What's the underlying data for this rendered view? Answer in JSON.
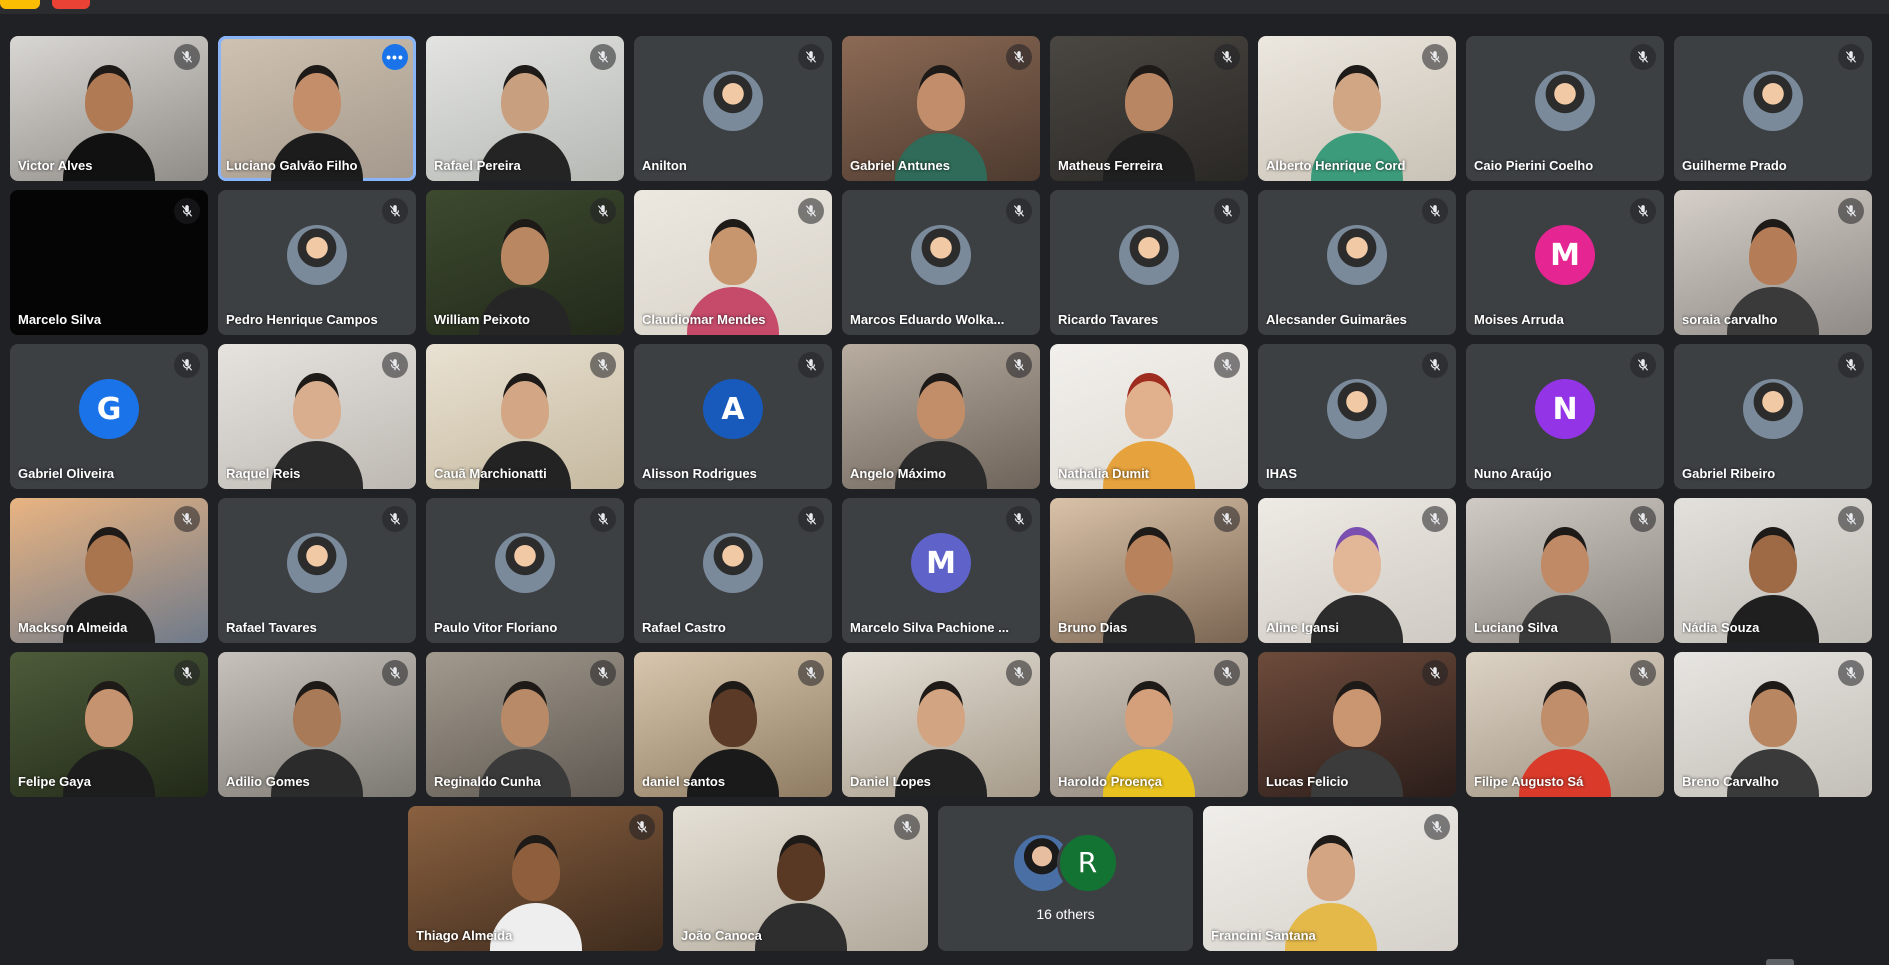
{
  "colors": {
    "background": "#202124",
    "tile": "#3c4043",
    "accent": "#1a73e8",
    "speaking_outline": "#8ab4f8"
  },
  "rows": [
    [
      {
        "name": "Victor Alves",
        "kind": "cam",
        "c1": "#d9d7d3",
        "c2": "#8f8c87",
        "skin": "#b07a55",
        "shirt": "#111111"
      },
      {
        "name": "Luciano Galvão Filho",
        "kind": "cam",
        "c1": "#cfc2b1",
        "c2": "#a3988c",
        "skin": "#c38e69",
        "shirt": "#1c1c1c",
        "speaking": true,
        "menu": true
      },
      {
        "name": "Rafael Pereira",
        "kind": "cam",
        "c1": "#e3e4e1",
        "c2": "#b6b8b4",
        "skin": "#c9a07f",
        "shirt": "#242424"
      },
      {
        "name": "Anilton",
        "kind": "photo"
      },
      {
        "name": "Gabriel Antunes",
        "kind": "cam",
        "c1": "#8c6a55",
        "c2": "#4d3a2f",
        "skin": "#c18d6a",
        "shirt": "#2f6b58"
      },
      {
        "name": "Matheus Ferreira",
        "kind": "cam",
        "c1": "#4a4742",
        "c2": "#2a2825",
        "skin": "#b88663",
        "shirt": "#1f1f1f"
      },
      {
        "name": "Alberto Henrique Cord",
        "kind": "cam",
        "c1": "#ece7df",
        "c2": "#c9c2b6",
        "skin": "#d1a685",
        "shirt": "#3c9b7b"
      },
      {
        "name": "Caio Pierini Coelho",
        "kind": "photo"
      },
      {
        "name": "Guilherme Prado",
        "kind": "photo"
      }
    ],
    [
      {
        "name": "Marcelo Silva",
        "kind": "black"
      },
      {
        "name": "Pedro Henrique Campos",
        "kind": "photo"
      },
      {
        "name": "William Peixoto",
        "kind": "cam",
        "c1": "#3d4a2f",
        "c2": "#22291a",
        "skin": "#b98862",
        "shirt": "#262626"
      },
      {
        "name": "Claudiomar Mendes",
        "kind": "cam",
        "c1": "#ece8e0",
        "c2": "#d8d2c8",
        "skin": "#c7966f",
        "shirt": "#c64b6b"
      },
      {
        "name": "Marcos Eduardo Wolka...",
        "kind": "photo"
      },
      {
        "name": "Ricardo Tavares",
        "kind": "photo"
      },
      {
        "name": "Alecsander Guimarães",
        "kind": "photo"
      },
      {
        "name": "Moises Arruda",
        "kind": "letter",
        "letter": "M",
        "color": "#e52592"
      },
      {
        "name": "soraia carvalho",
        "kind": "cam",
        "c1": "#d5cfc8",
        "c2": "#8f8a86",
        "skin": "#b47c57",
        "shirt": "#3a3a3a"
      }
    ],
    [
      {
        "name": "Gabriel Oliveira",
        "kind": "letter",
        "letter": "G",
        "color": "#1a73e8"
      },
      {
        "name": "Raquel Reis",
        "kind": "cam",
        "c1": "#e6e3df",
        "c2": "#bdb8b2",
        "skin": "#d9ae8e",
        "shirt": "#2a2a2a"
      },
      {
        "name": "Cauã Marchionatti",
        "kind": "cam",
        "c1": "#e9e1d2",
        "c2": "#c5b99f",
        "skin": "#d3a785",
        "shirt": "#232323"
      },
      {
        "name": "Alisson Rodrigues",
        "kind": "letter",
        "letter": "A",
        "color": "#185abc"
      },
      {
        "name": "Angelo Máximo",
        "kind": "cam",
        "c1": "#b8ada0",
        "c2": "#6d635a",
        "skin": "#c28d69",
        "shirt": "#2b2b2b"
      },
      {
        "name": "Nathalia Dumit",
        "kind": "cam",
        "c1": "#f2f0ec",
        "c2": "#dedad3",
        "skin": "#e0b18c",
        "shirt": "#e6a23c",
        "hair": "#9e2c1f"
      },
      {
        "name": "IHAS",
        "kind": "photo"
      },
      {
        "name": "Nuno Araújo",
        "kind": "letter",
        "letter": "N",
        "color": "#9334e6"
      },
      {
        "name": "Gabriel Ribeiro",
        "kind": "photo"
      }
    ],
    [
      {
        "name": "Mackson Almeida",
        "kind": "cam",
        "c1": "#e9b482",
        "c2": "#6f7a8a",
        "skin": "#a8754f",
        "shirt": "#1e1e1e"
      },
      {
        "name": "Rafael Tavares",
        "kind": "photo"
      },
      {
        "name": "Paulo Vitor Floriano",
        "kind": "photo"
      },
      {
        "name": "Rafael Castro",
        "kind": "photo"
      },
      {
        "name": "Marcelo Silva Pachione ...",
        "kind": "letter",
        "letter": "M",
        "color": "#5f63c9"
      },
      {
        "name": "Bruno Dias",
        "kind": "cam",
        "c1": "#d9c2a8",
        "c2": "#7a6552",
        "skin": "#b8825c",
        "shirt": "#2a2a2a"
      },
      {
        "name": "Aline Igansi",
        "kind": "cam",
        "c1": "#eeeae4",
        "c2": "#cfcac3",
        "skin": "#e1b797",
        "shirt": "#2c2c2c",
        "hair": "#7b4fb0"
      },
      {
        "name": "Luciano Silva",
        "kind": "cam",
        "c1": "#cfcac4",
        "c2": "#8a857e",
        "skin": "#c08a66",
        "shirt": "#3a3a3a"
      },
      {
        "name": "Nádia Souza",
        "kind": "cam",
        "c1": "#e3e1dc",
        "c2": "#bdb9b3",
        "skin": "#9e6a46",
        "shirt": "#1f1f1f"
      }
    ],
    [
      {
        "name": "Felipe Gaya",
        "kind": "cam",
        "c1": "#4d5b3a",
        "c2": "#222a18",
        "skin": "#c59370",
        "shirt": "#1d1d1d"
      },
      {
        "name": "Adilio Gomes",
        "kind": "cam",
        "c1": "#c7c2bb",
        "c2": "#7c7872",
        "skin": "#a97a58",
        "shirt": "#2b2b2b"
      },
      {
        "name": "Reginaldo Cunha",
        "kind": "cam",
        "c1": "#a29a8e",
        "c2": "#5f5952",
        "skin": "#b98a67",
        "shirt": "#3a3a3a"
      },
      {
        "name": "daniel santos",
        "kind": "cam",
        "c1": "#d8c7ae",
        "c2": "#8e7b62",
        "skin": "#5b3a27",
        "shirt": "#1a1a1a"
      },
      {
        "name": "Daniel Lopes",
        "kind": "cam",
        "c1": "#e4dfd6",
        "c2": "#a69b8a",
        "skin": "#d2a481",
        "shirt": "#222222"
      },
      {
        "name": "Haroldo Proença",
        "kind": "cam",
        "c1": "#cfc6bb",
        "c2": "#8c8277",
        "skin": "#d3a07b",
        "shirt": "#e8c21e"
      },
      {
        "name": "Lucas Felicio",
        "kind": "cam",
        "c1": "#6d4b3b",
        "c2": "#2b1d1a",
        "skin": "#c99671",
        "shirt": "#3b3b3b"
      },
      {
        "name": "Filipe Augusto Sá",
        "kind": "cam",
        "c1": "#ddd3c4",
        "c2": "#9f9383",
        "skin": "#c18e6b",
        "shirt": "#d93a2a"
      },
      {
        "name": "Breno Carvalho",
        "kind": "cam",
        "c1": "#e7e5e1",
        "c2": "#c3bfb8",
        "skin": "#b98662",
        "shirt": "#3a3a3a"
      }
    ]
  ],
  "last_row": [
    {
      "name": "Thiago Almeida",
      "kind": "cam",
      "c1": "#8a6140",
      "c2": "#3e2b1d",
      "skin": "#8f5f3d",
      "shirt": "#eeeeee"
    },
    {
      "name": "João Canoca",
      "kind": "cam",
      "c1": "#e5e0d6",
      "c2": "#b1a99b",
      "skin": "#5a3924",
      "shirt": "#2e2e2e"
    },
    {
      "name": "",
      "kind": "others",
      "letter": "R",
      "color": "#137333",
      "label": "16 others"
    },
    {
      "name": "Francini Santana",
      "kind": "cam",
      "c1": "#f0eeea",
      "c2": "#d5d1ca",
      "skin": "#d4a583",
      "shirt": "#e4b94a"
    }
  ]
}
